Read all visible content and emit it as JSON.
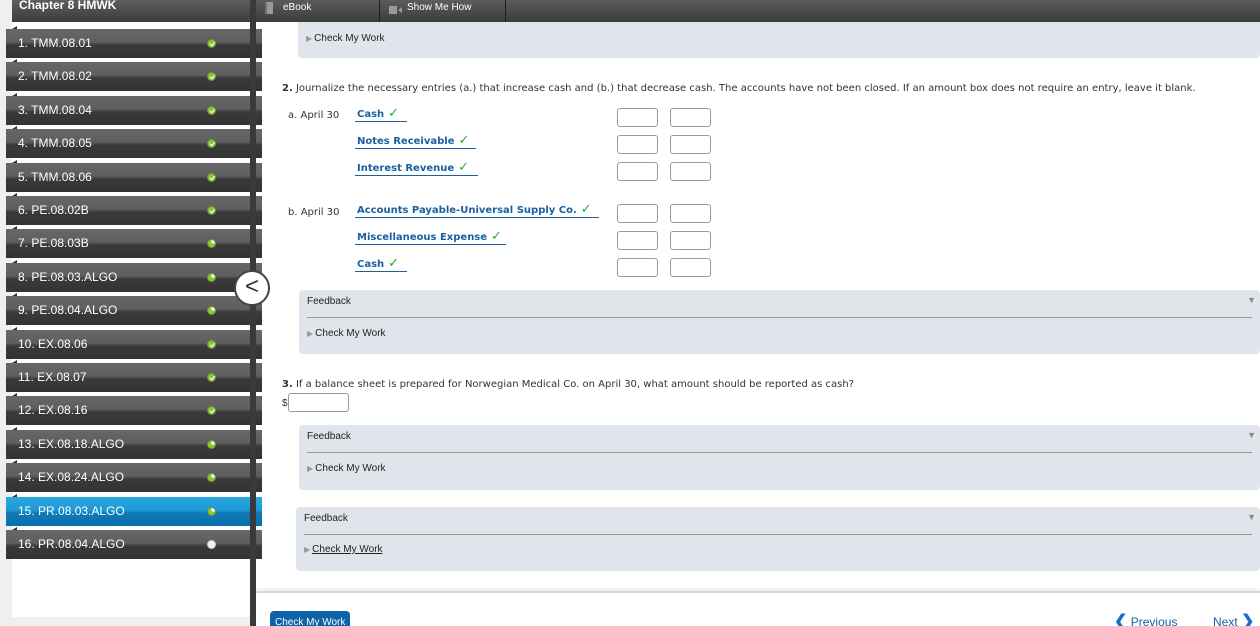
{
  "sidebar": {
    "title": "Chapter 8 HMWK",
    "collapse_label": "<",
    "items": [
      {
        "label": "1. TMM.08.01",
        "status": "complete"
      },
      {
        "label": "2. TMM.08.02",
        "status": "complete"
      },
      {
        "label": "3. TMM.08.04",
        "status": "complete"
      },
      {
        "label": "4. TMM.08.05",
        "status": "complete"
      },
      {
        "label": "5. TMM.08.06",
        "status": "complete"
      },
      {
        "label": "6. PE.08.02B",
        "status": "complete"
      },
      {
        "label": "7. PE.08.03B",
        "status": "partial"
      },
      {
        "label": "8. PE.08.03.ALGO",
        "status": "partial"
      },
      {
        "label": "9. PE.08.04.ALGO",
        "status": "partial"
      },
      {
        "label": "10. EX.08.06",
        "status": "complete"
      },
      {
        "label": "11. EX.08.07",
        "status": "complete"
      },
      {
        "label": "12. EX.08.16",
        "status": "complete"
      },
      {
        "label": "13. EX.08.18.ALGO",
        "status": "partial"
      },
      {
        "label": "14. EX.08.24.ALGO",
        "status": "partial"
      },
      {
        "label": "15. PR.08.03.ALGO",
        "status": "partial",
        "active": true
      },
      {
        "label": "16. PR.08.04.ALGO",
        "status": "empty"
      }
    ]
  },
  "toolbar": {
    "ebook_label": "eBook",
    "show_me_how_label": "Show Me How"
  },
  "top_panel": {
    "check_my_work": "Check My Work"
  },
  "question2": {
    "number": "2.",
    "text": "Journalize the necessary entries (a.) that increase cash and (b.) that decrease cash. The accounts have not been closed. If an amount box does not require an entry, leave it blank.",
    "entries": [
      {
        "date": "a. April 30",
        "accounts": [
          "Cash",
          "Notes Receivable",
          "Interest Revenue"
        ]
      },
      {
        "date": "b. April 30",
        "accounts": [
          "Accounts Payable-Universal Supply Co.",
          "Miscellaneous Expense",
          "Cash"
        ]
      }
    ],
    "check_mark": "✓",
    "feedback_label": "Feedback",
    "check_my_work": "Check My Work"
  },
  "question3": {
    "number": "3.",
    "text": "If a balance sheet is prepared for Norwegian Medical Co. on April 30, what amount should be reported as cash?",
    "currency": "$",
    "value": "",
    "feedback_label": "Feedback",
    "check_my_work": "Check My Work"
  },
  "overall_feedback": {
    "label": "Feedback",
    "check_my_work": "Check My Work"
  },
  "footer": {
    "check_my_work_button": "Check My Work",
    "previous_label": "Previous",
    "next_label": "Next"
  },
  "colors": {
    "accent_blue": "#0c63a8",
    "account_blue": "#1a5fa0",
    "check_green": "#1fb02a",
    "status_green": "#8cc63f",
    "active_item": "#1f9ad6",
    "panel_bg": "#dfe5ea"
  }
}
